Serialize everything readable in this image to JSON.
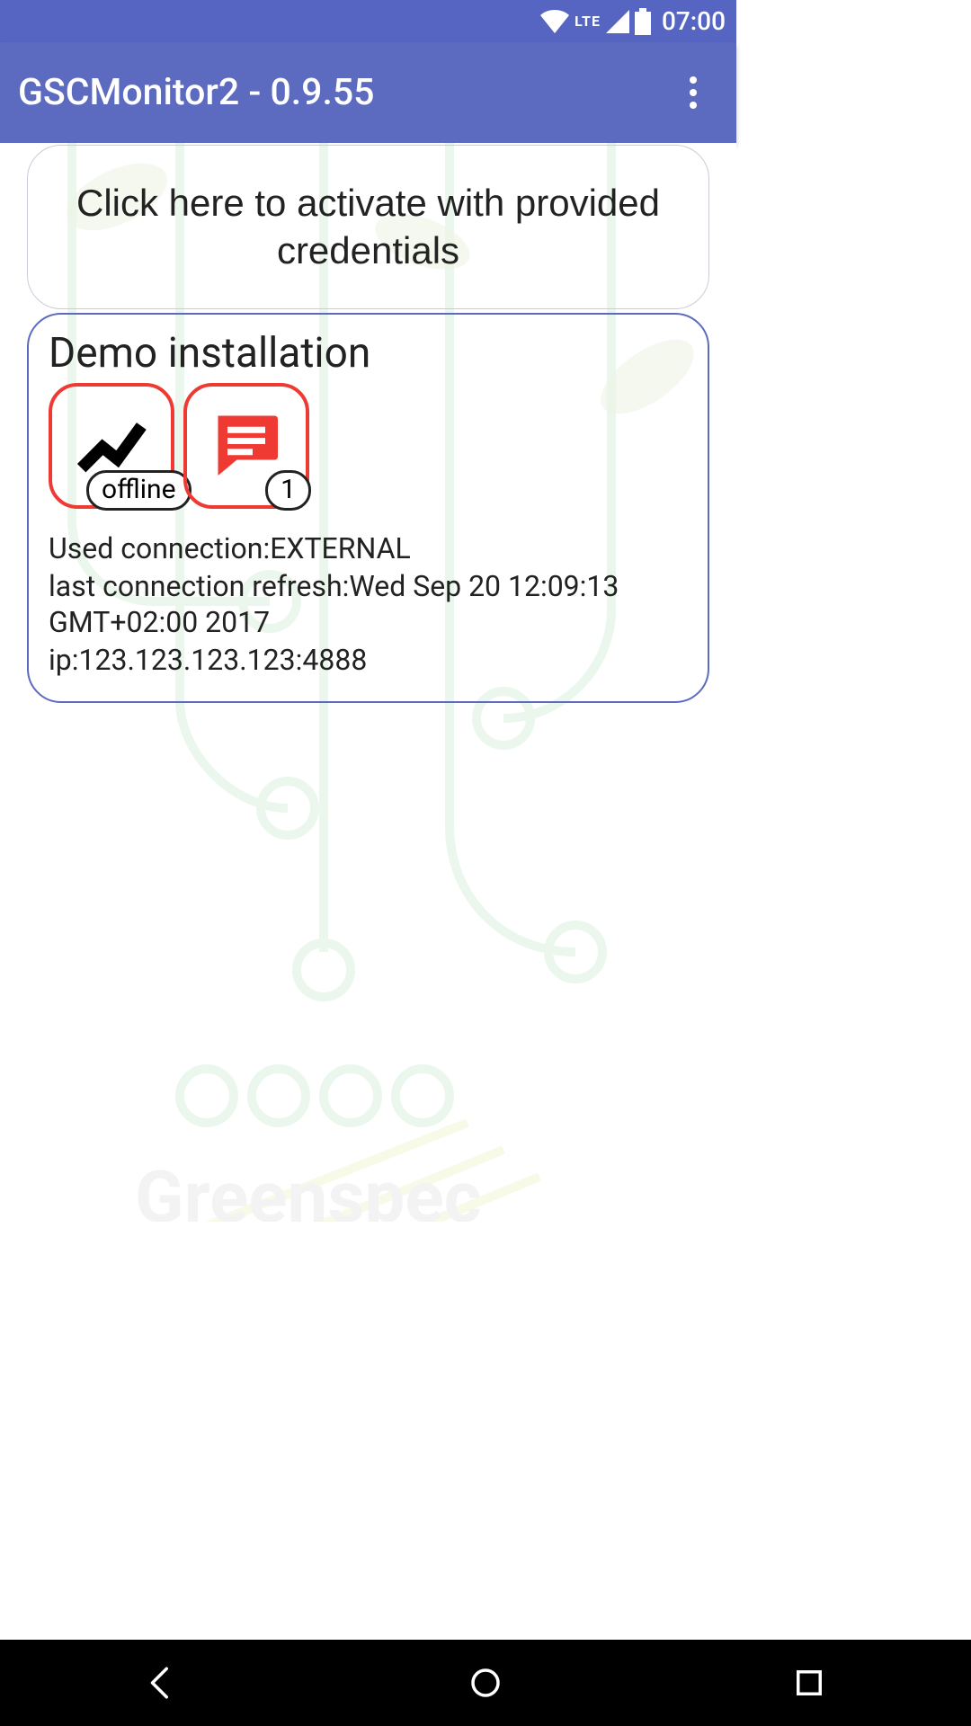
{
  "status": {
    "lte_label": "LTE",
    "time": "07:00"
  },
  "appbar": {
    "title": "GSCMonitor2 - 0.9.55"
  },
  "content": {
    "activate_label": "Click here to activate with provided credentials",
    "card": {
      "title": "Demo installation",
      "status_badge": "offline",
      "message_count": "1",
      "used_connection_label": "Used connection:",
      "used_connection_value": "EXTERNAL",
      "last_refresh_label": "last connection refresh:",
      "last_refresh_value": "Wed Sep 20 12:09:13 GMT+02:00 2017",
      "ip_label": "ip:",
      "ip_value": "123.123.123.123:4888"
    }
  },
  "bg_brand": "Greenspec"
}
